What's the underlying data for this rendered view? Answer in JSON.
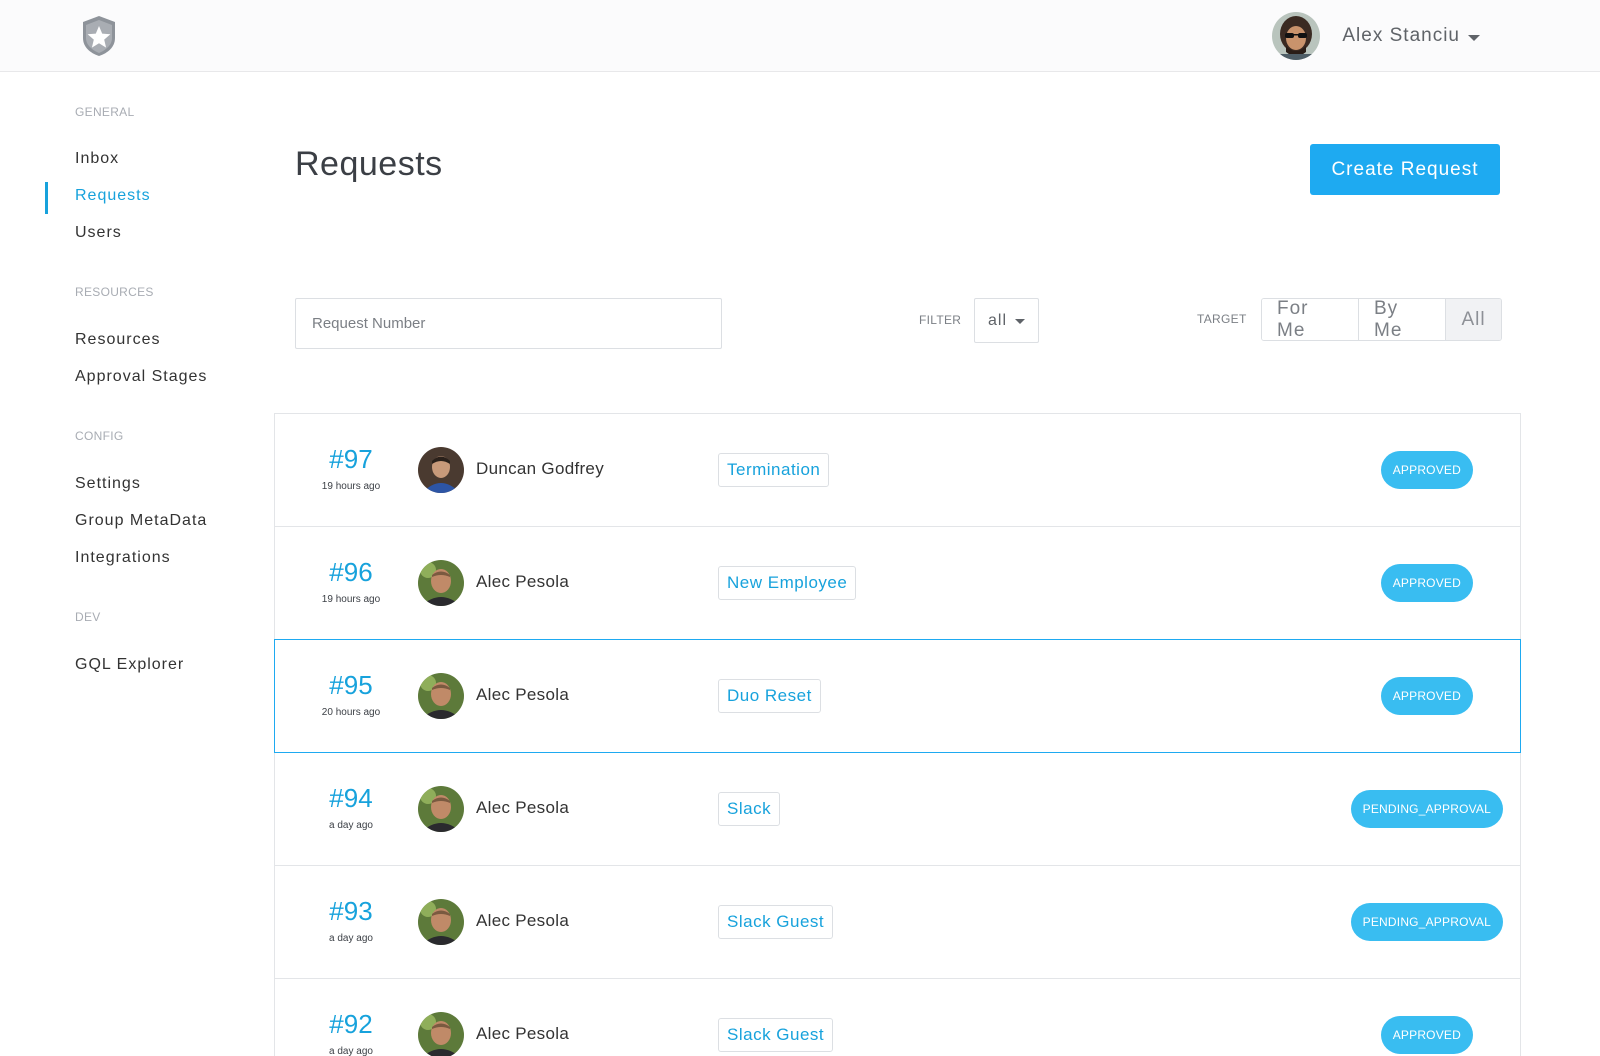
{
  "header": {
    "user_name": "Alex Stanciu",
    "logo_icon": "shield-star-icon"
  },
  "sidebar": {
    "sections": [
      {
        "label": "GENERAL",
        "items": [
          "Inbox",
          "Requests",
          "Users"
        ]
      },
      {
        "label": "RESOURCES",
        "items": [
          "Resources",
          "Approval Stages"
        ]
      },
      {
        "label": "CONFIG",
        "items": [
          "Settings",
          "Group MetaData",
          "Integrations"
        ]
      },
      {
        "label": "DEV",
        "items": [
          "GQL Explorer"
        ]
      }
    ],
    "active_item": "Requests"
  },
  "main": {
    "title": "Requests",
    "create_button": "Create Request",
    "search_placeholder": "Request Number",
    "filter_label": "FILTER",
    "filter_value": "all",
    "target_label": "TARGET",
    "target_options": [
      "For Me",
      "By Me",
      "All"
    ],
    "target_active": "All"
  },
  "requests": [
    {
      "number": "#97",
      "time": "19 hours ago",
      "user": "Duncan Godfrey",
      "type": "Termination",
      "status": "APPROVED"
    },
    {
      "number": "#96",
      "time": "19 hours ago",
      "user": "Alec Pesola",
      "type": "New Employee",
      "status": "APPROVED"
    },
    {
      "number": "#95",
      "time": "20 hours ago",
      "user": "Alec Pesola",
      "type": "Duo Reset",
      "status": "APPROVED"
    },
    {
      "number": "#94",
      "time": "a day ago",
      "user": "Alec Pesola",
      "type": "Slack",
      "status": "PENDING_APPROVAL"
    },
    {
      "number": "#93",
      "time": "a day ago",
      "user": "Alec Pesola",
      "type": "Slack Guest",
      "status": "PENDING_APPROVAL"
    },
    {
      "number": "#92",
      "time": "a day ago",
      "user": "Alec Pesola",
      "type": "Slack Guest",
      "status": "APPROVED"
    }
  ],
  "colors": {
    "accent": "#17a2dc",
    "button": "#1eaaf1",
    "status_badge": "#39bdf1"
  }
}
